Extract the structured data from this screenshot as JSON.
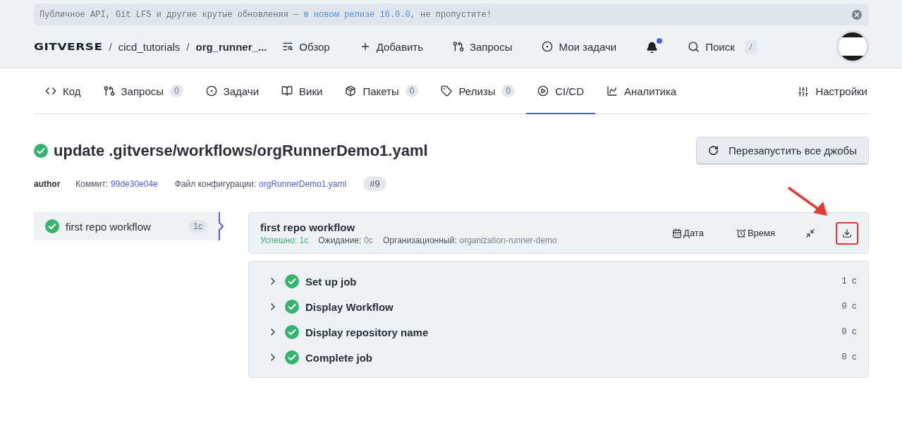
{
  "banner": {
    "text": "Публичное API, Git LFS и другие крутые обновления — ",
    "link": "в новом релизе 16.0.0",
    "suffix": ", не пропустите!"
  },
  "header": {
    "logo": "GITVERSE",
    "breadcrumbs": [
      {
        "separator": "/",
        "label": "cicd_tutorials",
        "current": false
      },
      {
        "separator": "/",
        "label": "org_runner_...",
        "current": true
      }
    ],
    "nav": [
      {
        "label": "Обзор"
      },
      {
        "label": "Добавить"
      },
      {
        "label": "Запросы"
      },
      {
        "label": "Мои задачи"
      }
    ],
    "notifications": {
      "unread": true
    },
    "search": {
      "label": "Поиск",
      "shortcut": "/"
    }
  },
  "tabs": [
    {
      "label": "Код",
      "selected": false
    },
    {
      "label": "Запросы",
      "count": "0",
      "selected": false
    },
    {
      "label": "Задачи",
      "selected": false
    },
    {
      "label": "Вики",
      "selected": false
    },
    {
      "label": "Пакеты",
      "count": "0",
      "selected": false
    },
    {
      "label": "Релизы",
      "count": "0",
      "selected": false
    },
    {
      "label": "CI/CD",
      "selected": true
    },
    {
      "label": "Аналитика",
      "selected": false
    }
  ],
  "settings_tab": {
    "label": "Настройки"
  },
  "run": {
    "title": "update .gitverse/workflows/orgRunnerDemo1.yaml",
    "author": "author",
    "commit_label": "Коммит:",
    "commit": "99de30e04e",
    "config_label": "Файл конфигурации:",
    "config": "orgRunnerDemo1.yaml",
    "number": "#9",
    "rerun": "Перезапустить все джобы"
  },
  "jobs": [
    {
      "name": "first repo workflow",
      "duration": "1с",
      "selected": true
    }
  ],
  "job_detail": {
    "name": "first repo workflow",
    "success": "Успешно: 1с",
    "wait_label": "Ожидание:",
    "wait": "0с",
    "org_label": "Организационный:",
    "org": "organization-runner-demo",
    "actions": [
      {
        "kind": "date",
        "label": "Дата",
        "highlighted": false
      },
      {
        "kind": "time",
        "label": "Время",
        "highlighted": false
      },
      {
        "kind": "fullscreen",
        "highlighted": false
      },
      {
        "kind": "download",
        "highlighted": true
      }
    ]
  },
  "steps": [
    {
      "expanded": false,
      "name": "Set up job",
      "duration": "1 с"
    },
    {
      "expanded": false,
      "name": "Display Workflow",
      "duration": "0 с"
    },
    {
      "expanded": false,
      "name": "Display repository name",
      "duration": "0 с"
    },
    {
      "expanded": false,
      "name": "Complete job",
      "duration": "0 с"
    }
  ]
}
